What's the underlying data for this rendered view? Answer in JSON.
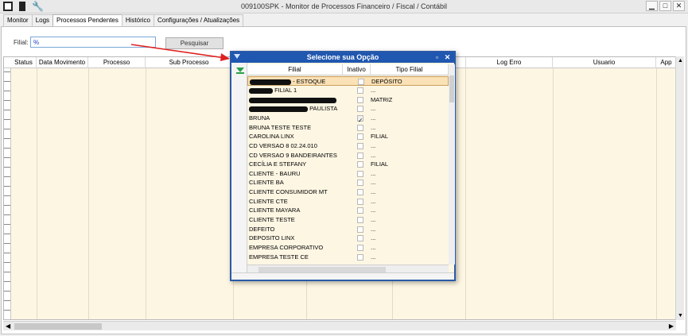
{
  "window": {
    "title": "009100SPK - Monitor de Processos Financeiro / Fiscal / Contábil",
    "buttons": [
      "▁",
      "□",
      "✕"
    ]
  },
  "tabs": [
    {
      "label": "Monitor",
      "active": false
    },
    {
      "label": "Logs",
      "active": false
    },
    {
      "label": "Processos Pendentes",
      "active": true
    },
    {
      "label": "Histórico",
      "active": false
    },
    {
      "label": "Configurações / Atualizações",
      "active": false
    }
  ],
  "filter": {
    "label": "Filial:",
    "value": "%",
    "search_button": "Pesquisar"
  },
  "grid": {
    "columns": [
      "Status",
      "Data Movimento",
      "Processo",
      "Sub Processo",
      "Log Erro",
      "Usuario",
      "App"
    ]
  },
  "dialog": {
    "title": "Selecione sua Opção",
    "columns": [
      "Filial",
      "Inativo",
      "Tipo Filial"
    ],
    "rows": [
      {
        "filial": "- ESTOQUE",
        "redacted_prefix": true,
        "inativo": false,
        "tipo": "DEPÓSITO",
        "selected": true
      },
      {
        "filial": "FILIAL 1",
        "redacted_prefix": true,
        "inativo": false,
        "tipo": "..."
      },
      {
        "filial": "",
        "redacted_prefix": true,
        "inativo": false,
        "tipo": "MATRIZ"
      },
      {
        "filial": "PAULISTA",
        "redacted_prefix": true,
        "inativo": false,
        "tipo": "..."
      },
      {
        "filial": "BRUNA",
        "inativo": true,
        "tipo": "..."
      },
      {
        "filial": "BRUNA TESTE TESTE",
        "inativo": false,
        "tipo": "..."
      },
      {
        "filial": "CAROLINA LINX",
        "inativo": false,
        "tipo": "FILIAL"
      },
      {
        "filial": "CD VERSAO 8 02.24.010",
        "inativo": false,
        "tipo": "..."
      },
      {
        "filial": "CD VERSAO 9 BANDEIRANTES",
        "inativo": false,
        "tipo": "..."
      },
      {
        "filial": "CECÍLIA E STEFANY",
        "inativo": false,
        "tipo": "FILIAL"
      },
      {
        "filial": "CLIENTE - BAURU",
        "inativo": false,
        "tipo": "..."
      },
      {
        "filial": "CLIENTE BA",
        "inativo": false,
        "tipo": "..."
      },
      {
        "filial": "CLIENTE CONSUMIDOR MT",
        "inativo": false,
        "tipo": "..."
      },
      {
        "filial": "CLIENTE CTE",
        "inativo": false,
        "tipo": "..."
      },
      {
        "filial": "CLIENTE MAYARA",
        "inativo": false,
        "tipo": "..."
      },
      {
        "filial": "CLIENTE TESTE",
        "inativo": false,
        "tipo": "..."
      },
      {
        "filial": "DEFEITO",
        "inativo": false,
        "tipo": "..."
      },
      {
        "filial": "DEPOSITO LINX",
        "inativo": false,
        "tipo": "..."
      },
      {
        "filial": "EMPRESA CORPORATIVO",
        "inativo": false,
        "tipo": "..."
      },
      {
        "filial": "EMPRESA TESTE CE",
        "inativo": false,
        "tipo": "..."
      }
    ]
  },
  "colors": {
    "dialog_title_bg": "#2057b0",
    "grid_bg": "#fdf6e3",
    "selected_row": "#fbe1b6",
    "arrow": "#e02020"
  }
}
